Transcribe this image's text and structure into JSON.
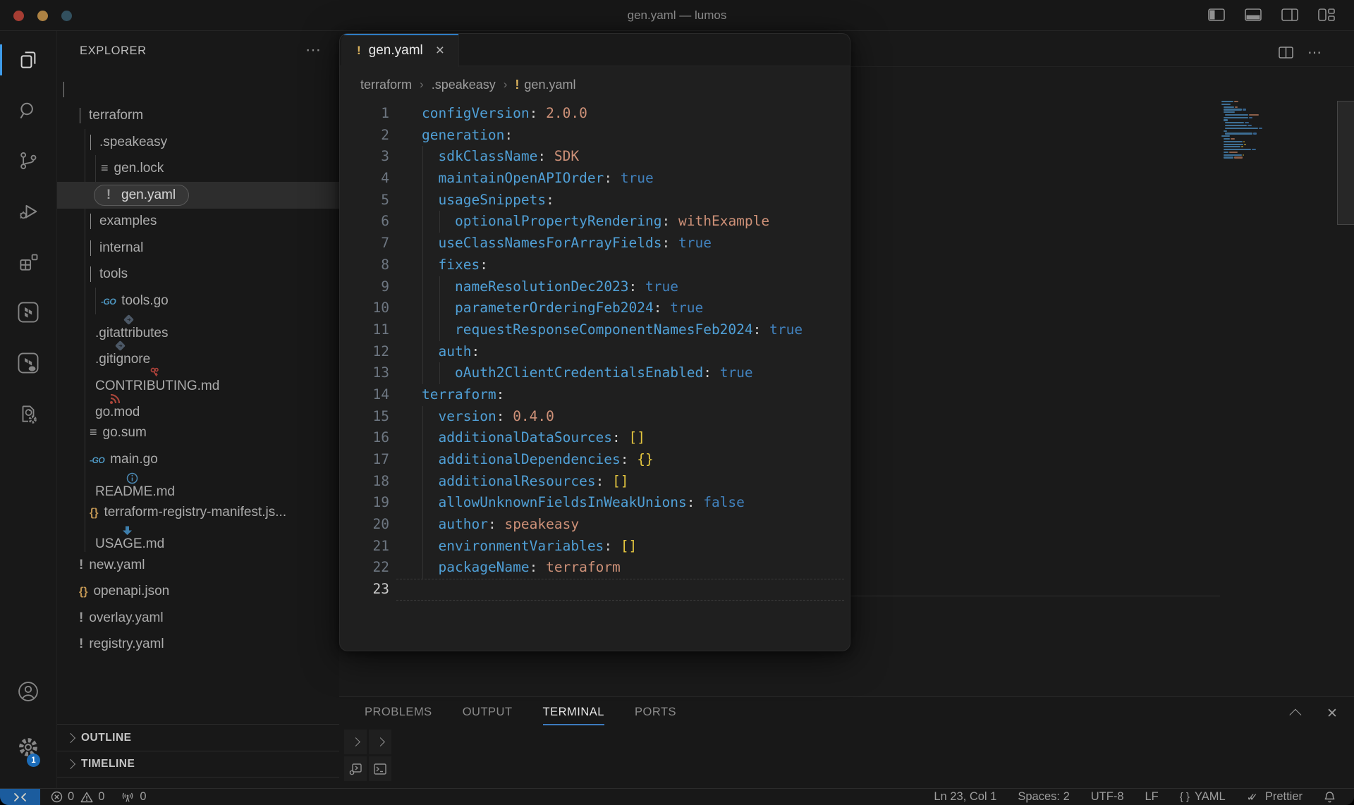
{
  "window": {
    "title": "gen.yaml — lumos"
  },
  "titlebar": {
    "layout_buttons": [
      "toggle-primary-sidebar",
      "toggle-panel",
      "toggle-secondary-sidebar",
      "customize-layout"
    ]
  },
  "activity_bar": {
    "items": [
      {
        "name": "explorer",
        "active": true
      },
      {
        "name": "search"
      },
      {
        "name": "source-control"
      },
      {
        "name": "run-and-debug"
      },
      {
        "name": "extensions"
      },
      {
        "name": "terraform"
      },
      {
        "name": "terraform-cloud"
      },
      {
        "name": "code-config"
      }
    ],
    "bottom": [
      {
        "name": "accounts"
      },
      {
        "name": "settings",
        "badge": "1"
      }
    ]
  },
  "explorer": {
    "header": "EXPLORER",
    "more_icon": "⋯",
    "tree": [
      {
        "label": "",
        "redacted": true,
        "kind": "folder",
        "depth": 0,
        "expanded": true
      },
      {
        "label": "terraform",
        "kind": "folder",
        "depth": 1,
        "expanded": true
      },
      {
        "label": ".speakeasy",
        "kind": "folder",
        "depth": 2,
        "expanded": true
      },
      {
        "label": "gen.lock",
        "kind": "file",
        "icon": "list",
        "depth": 3
      },
      {
        "label": "gen.yaml",
        "kind": "file",
        "icon": "yaml",
        "depth": 3,
        "selected": true
      },
      {
        "label": "examples",
        "kind": "folder",
        "depth": 2,
        "expanded": false
      },
      {
        "label": "internal",
        "kind": "folder",
        "depth": 2,
        "expanded": false
      },
      {
        "label": "tools",
        "kind": "folder",
        "depth": 2,
        "expanded": true
      },
      {
        "label": "tools.go",
        "kind": "file",
        "icon": "go",
        "depth": 3
      },
      {
        "label": ".gitattributes",
        "kind": "file",
        "icon": "git",
        "depth": 2
      },
      {
        "label": ".gitignore",
        "kind": "file",
        "icon": "git",
        "depth": 2
      },
      {
        "label": "CONTRIBUTING.md",
        "kind": "file",
        "icon": "keys",
        "depth": 2
      },
      {
        "label": "go.mod",
        "kind": "file",
        "icon": "rss",
        "depth": 2
      },
      {
        "label": "go.sum",
        "kind": "file",
        "icon": "list",
        "depth": 2
      },
      {
        "label": "main.go",
        "kind": "file",
        "icon": "go",
        "depth": 2
      },
      {
        "label": "README.md",
        "kind": "file",
        "icon": "info",
        "depth": 2
      },
      {
        "label": "terraform-registry-manifest.js...",
        "kind": "file",
        "icon": "braces",
        "depth": 2
      },
      {
        "label": "USAGE.md",
        "kind": "file",
        "icon": "arrow-down",
        "depth": 2
      },
      {
        "label": "new.yaml",
        "kind": "file",
        "icon": "yaml",
        "depth": 1
      },
      {
        "label": "openapi.json",
        "kind": "file",
        "icon": "braces",
        "depth": 1
      },
      {
        "label": "overlay.yaml",
        "kind": "file",
        "icon": "yaml",
        "depth": 1
      },
      {
        "label": "registry.yaml",
        "kind": "file",
        "icon": "yaml",
        "depth": 1
      }
    ],
    "sections": [
      {
        "label": "OUTLINE"
      },
      {
        "label": "TIMELINE"
      }
    ]
  },
  "editor": {
    "tab": {
      "icon": "!",
      "label": "gen.yaml",
      "close": "×"
    },
    "breadcrumb_sep": "›",
    "breadcrumbs": [
      {
        "label": "terraform"
      },
      {
        "label": ".speakeasy"
      },
      {
        "label": "gen.yaml",
        "icon": "!"
      }
    ],
    "lines": [
      {
        "n": 1,
        "indent": 0,
        "key": "configVersion",
        "value": "2.0.0",
        "vt": "str"
      },
      {
        "n": 2,
        "indent": 0,
        "key": "generation"
      },
      {
        "n": 3,
        "indent": 1,
        "key": "sdkClassName",
        "value": "SDK",
        "vt": "str"
      },
      {
        "n": 4,
        "indent": 1,
        "key": "maintainOpenAPIOrder",
        "value": "true",
        "vt": "bool"
      },
      {
        "n": 5,
        "indent": 1,
        "key": "usageSnippets"
      },
      {
        "n": 6,
        "indent": 2,
        "key": "optionalPropertyRendering",
        "value": "withExample",
        "vt": "str"
      },
      {
        "n": 7,
        "indent": 1,
        "key": "useClassNamesForArrayFields",
        "value": "true",
        "vt": "bool"
      },
      {
        "n": 8,
        "indent": 1,
        "key": "fixes"
      },
      {
        "n": 9,
        "indent": 2,
        "key": "nameResolutionDec2023",
        "value": "true",
        "vt": "bool"
      },
      {
        "n": 10,
        "indent": 2,
        "key": "parameterOrderingFeb2024",
        "value": "true",
        "vt": "bool"
      },
      {
        "n": 11,
        "indent": 2,
        "key": "requestResponseComponentNamesFeb2024",
        "value": "true",
        "vt": "bool"
      },
      {
        "n": 12,
        "indent": 1,
        "key": "auth"
      },
      {
        "n": 13,
        "indent": 2,
        "key": "oAuth2ClientCredentialsEnabled",
        "value": "true",
        "vt": "bool"
      },
      {
        "n": 14,
        "indent": 0,
        "key": "terraform"
      },
      {
        "n": 15,
        "indent": 1,
        "key": "version",
        "value": "0.4.0",
        "vt": "str"
      },
      {
        "n": 16,
        "indent": 1,
        "key": "additionalDataSources",
        "value": "[]",
        "vt": "bracket"
      },
      {
        "n": 17,
        "indent": 1,
        "key": "additionalDependencies",
        "value": "{}",
        "vt": "bracket"
      },
      {
        "n": 18,
        "indent": 1,
        "key": "additionalResources",
        "value": "[]",
        "vt": "bracket"
      },
      {
        "n": 19,
        "indent": 1,
        "key": "allowUnknownFieldsInWeakUnions",
        "value": "false",
        "vt": "bool"
      },
      {
        "n": 20,
        "indent": 1,
        "key": "author",
        "value": "speakeasy",
        "vt": "str"
      },
      {
        "n": 21,
        "indent": 1,
        "key": "environmentVariables",
        "value": "[]",
        "vt": "bracket"
      },
      {
        "n": 22,
        "indent": 1,
        "key": "packageName",
        "value": "terraform",
        "vt": "str"
      },
      {
        "n": 23,
        "indent": 0,
        "current": true
      }
    ]
  },
  "panel": {
    "tabs": [
      {
        "label": "PROBLEMS"
      },
      {
        "label": "OUTPUT"
      },
      {
        "label": "TERMINAL",
        "active": true
      },
      {
        "label": "PORTS"
      }
    ]
  },
  "status_bar": {
    "left": [
      {
        "icon": "error",
        "value": "0"
      },
      {
        "icon": "warning",
        "value": "0"
      },
      {
        "icon": "broadcast",
        "value": "0"
      }
    ],
    "right": [
      {
        "label": "Ln 23, Col 1"
      },
      {
        "label": "Spaces: 2"
      },
      {
        "label": "UTF-8"
      },
      {
        "label": "LF"
      },
      {
        "icon": "braces",
        "label": "YAML"
      },
      {
        "icon": "double-check",
        "label": "Prettier"
      }
    ]
  },
  "colors": {
    "accent_blue": "#3c7bbe",
    "key": "#50a0d7",
    "bool": "#4182be",
    "string": "#ce9178",
    "bracket": "#e4c63f",
    "badge": "#1c6cb8",
    "remote": "#1b5c9e",
    "warn_icon": "#ddb45e"
  }
}
